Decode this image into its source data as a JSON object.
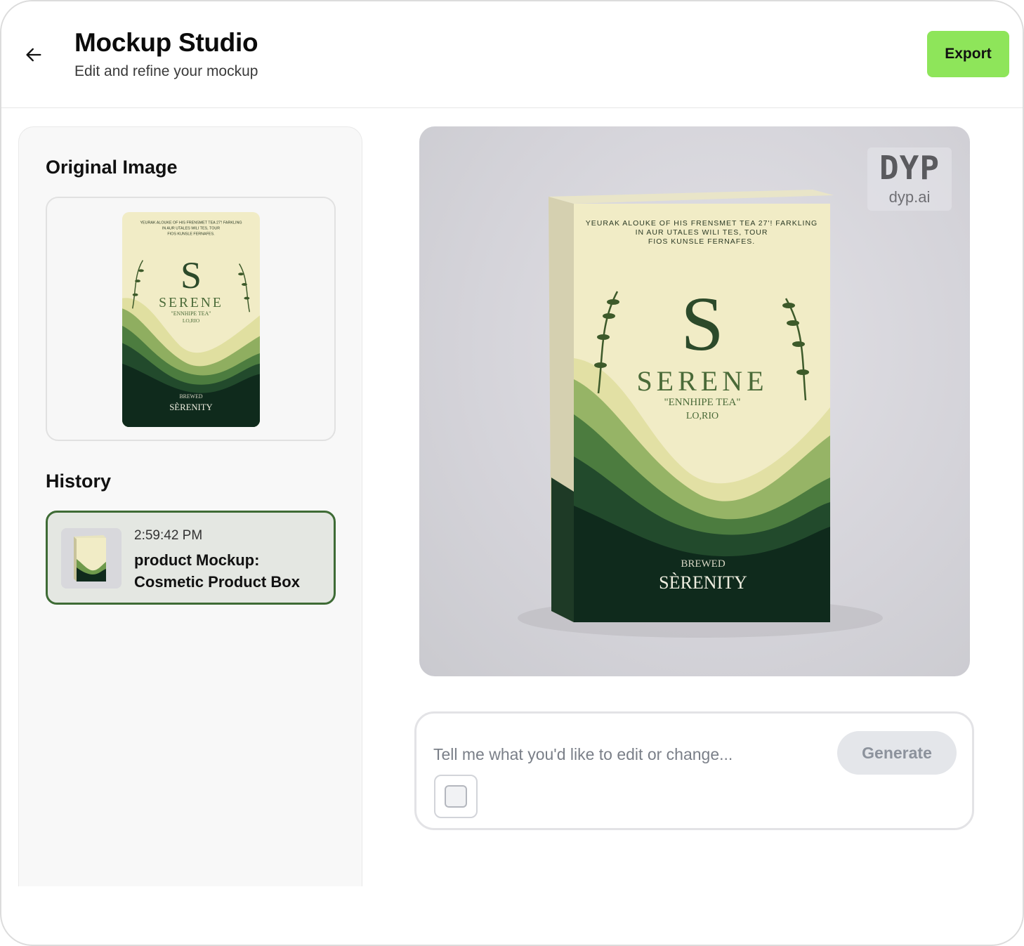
{
  "header": {
    "title": "Mockup Studio",
    "subtitle": "Edit and refine your mockup",
    "export_label": "Export",
    "back_icon": "arrow-left-icon"
  },
  "sidebar": {
    "original_heading": "Original Image",
    "history_heading": "History",
    "history": [
      {
        "time": "2:59:42 PM",
        "title": "product Mockup: Cosmetic Product Box"
      }
    ]
  },
  "artwork": {
    "top_copy": [
      "YEURAK ALOUKE OF HIS FRENSMET TEA 27'! FARKLING",
      "IN AUR UTALES WILI TES, TOUR",
      "FIOS KUNSLE FERNAFES."
    ],
    "monogram": "S",
    "brand": "SERENE",
    "variant": "\"ENNHIPE TEA\"",
    "sub": "LO,RIO",
    "footer_small": "BREWED",
    "footer_large": "SÈRENITY"
  },
  "watermark": {
    "logo": "DYP",
    "url": "dyp.ai"
  },
  "prompt": {
    "placeholder": "Tell me what you'd like to edit or change...",
    "generate_label": "Generate",
    "attach_icon": "image-attach-icon"
  },
  "colors": {
    "accent": "#8ee55a",
    "history_border": "#3e6b35",
    "box_cream": "#f1ecc6",
    "box_dark_green": "#0f2a1c"
  }
}
